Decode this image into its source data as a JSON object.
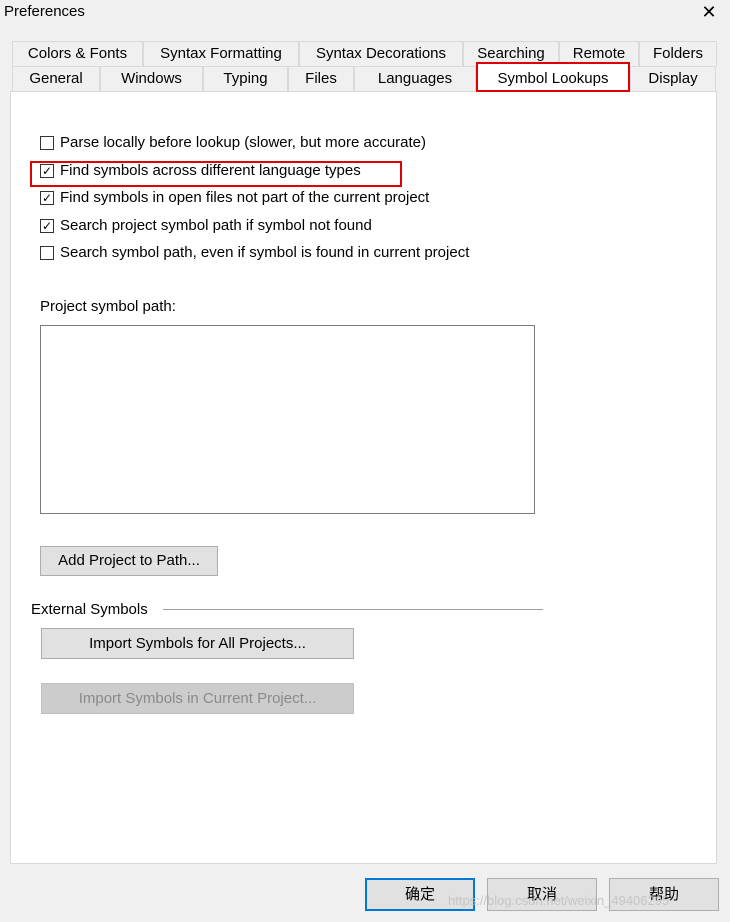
{
  "window": {
    "title": "Preferences"
  },
  "tabs_row1": [
    {
      "label": "Colors & Fonts"
    },
    {
      "label": "Syntax Formatting"
    },
    {
      "label": "Syntax Decorations"
    },
    {
      "label": "Searching"
    },
    {
      "label": "Remote"
    },
    {
      "label": "Folders"
    }
  ],
  "tabs_row2": [
    {
      "label": "General"
    },
    {
      "label": "Windows"
    },
    {
      "label": "Typing"
    },
    {
      "label": "Files"
    },
    {
      "label": "Languages"
    },
    {
      "label": "Symbol Lookups",
      "selected": true
    },
    {
      "label": "Display"
    }
  ],
  "options": [
    {
      "label": "Parse locally before lookup (slower, but more accurate)",
      "checked": false
    },
    {
      "label": "Find symbols across different language types",
      "checked": true
    },
    {
      "label": "Find symbols in open files not part of the current project",
      "checked": true
    },
    {
      "label": "Search project symbol path if symbol not found",
      "checked": true
    },
    {
      "label": "Search symbol path, even if symbol is found in current project",
      "checked": false
    }
  ],
  "project_path": {
    "label": "Project symbol path:",
    "value": "",
    "add_button": "Add Project to Path..."
  },
  "external": {
    "label": "External Symbols",
    "import_all": "Import Symbols for All Projects...",
    "import_current": "Import Symbols in Current Project..."
  },
  "footer": {
    "ok": "确定",
    "cancel": "取消",
    "help": "帮助"
  },
  "watermark": "https://blog.csdn.net/weixin_49406295",
  "colors": {
    "highlight": "#e00000",
    "focus": "#0078d7"
  }
}
